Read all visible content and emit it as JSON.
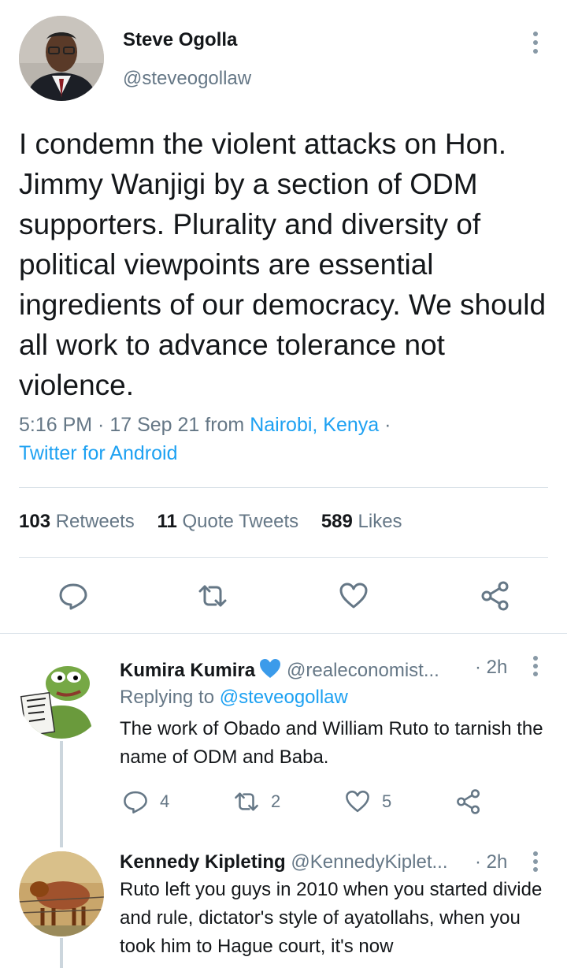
{
  "main_tweet": {
    "author_name": "Steve Ogolla",
    "author_handle": "@steveogollaw",
    "text": "I condemn the violent attacks on Hon. Jimmy Wanjigi by a section of ODM supporters. Plurality and diversity of political viewpoints are essential ingredients of our democracy. We should all work to advance tolerance not violence.",
    "time_date": "5:16 PM · 17 Sep 21 from ",
    "location": "Nairobi, Kenya",
    "sep": " ·",
    "source": "Twitter for Android",
    "stats": {
      "retweets_count": "103",
      "retweets_label": "Retweets",
      "quote_count": "11",
      "quote_label": "Quote Tweets",
      "likes_count": "589",
      "likes_label": "Likes"
    },
    "actions": [
      "reply-icon",
      "retweet-icon",
      "like-icon",
      "share-icon"
    ]
  },
  "replies": [
    {
      "name": "Kumira Kumira",
      "verified_emoji": "blue-heart-icon",
      "handle": "@realeconomist...",
      "time": "· 2h",
      "replying_prefix": "Replying to ",
      "replying_to": "@steveogollaw",
      "text": "The work of Obado and William Ruto to tarnish the name of ODM and Baba.",
      "reply_count": "4",
      "retweet_count": "2",
      "like_count": "5"
    },
    {
      "name": "Kennedy Kipleting",
      "handle": "@KennedyKiplet...",
      "time": "· 2h",
      "text": "Ruto left you guys in 2010 when you started divide and rule, dictator's style of ayatollahs, when you took him to Hague court, it's now"
    }
  ],
  "colors": {
    "accent": "#1da1f2",
    "muted": "#657786",
    "text": "#14171a",
    "divider": "#d9e1e8"
  }
}
